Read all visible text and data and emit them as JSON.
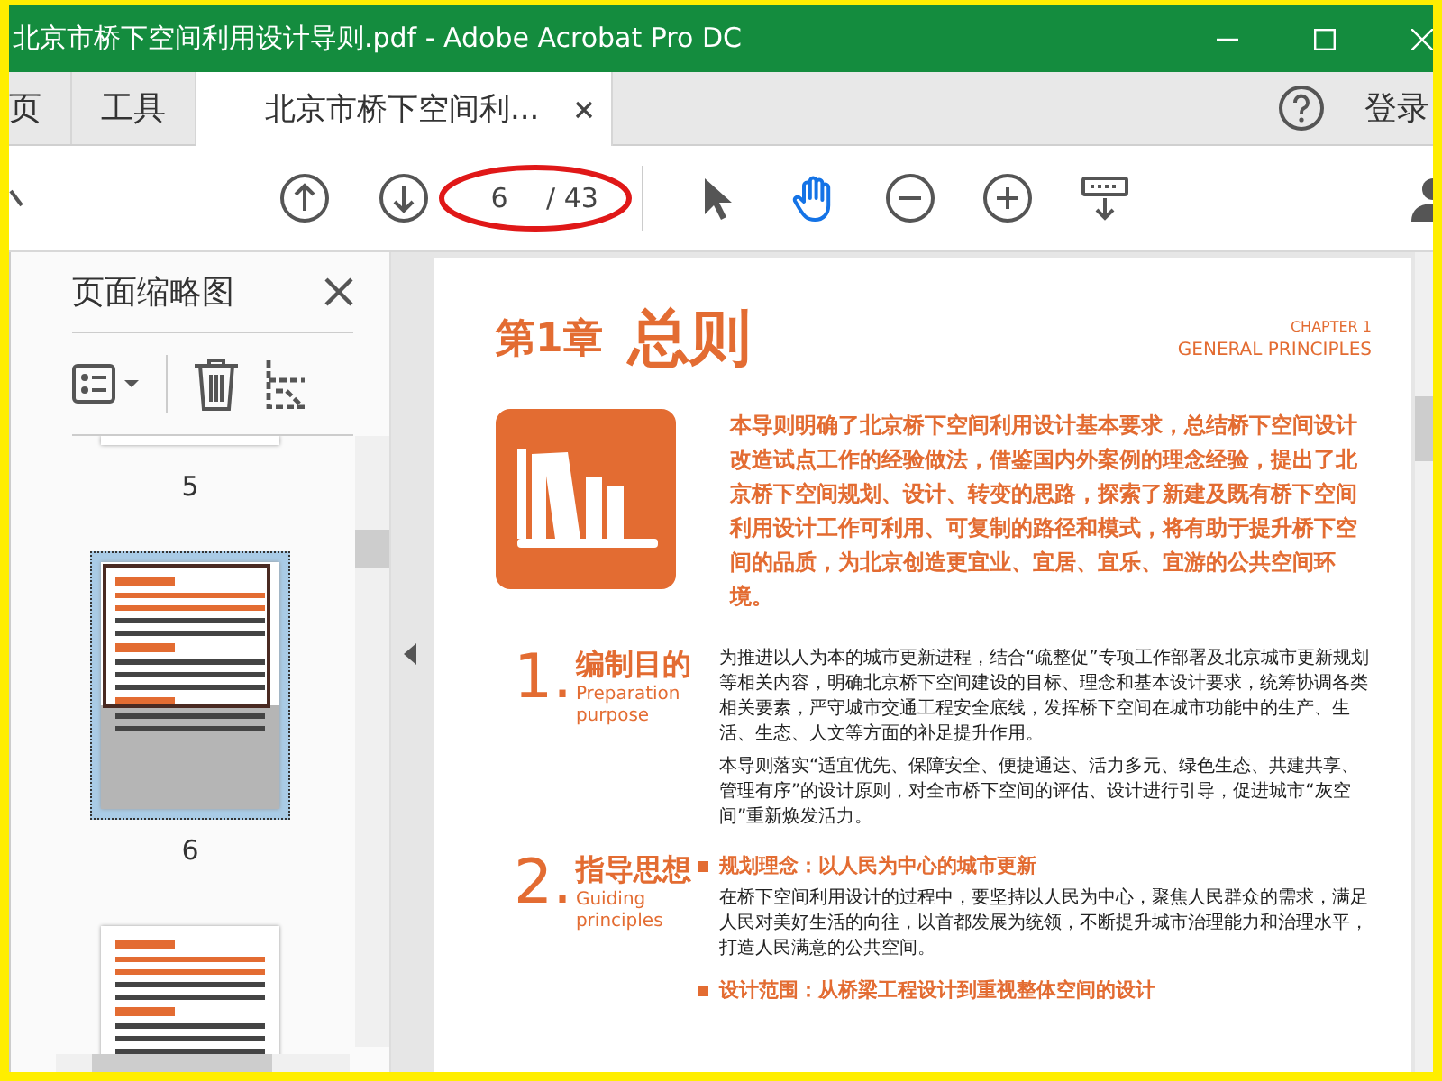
{
  "window": {
    "title": "北京市桥下空间利用设计导则.pdf - Adobe Acrobat Pro DC"
  },
  "tabs": [
    {
      "label": "页",
      "selected": false
    },
    {
      "label": "工具",
      "selected": false
    },
    {
      "label": "北京市桥下空间利...",
      "selected": true
    }
  ],
  "account": {
    "label": "登录"
  },
  "toolbar": {
    "page_value": "6",
    "page_total": "/ 43",
    "tools": [
      {
        "kind": "pointer",
        "selected": false
      },
      {
        "kind": "hand",
        "selected": true
      },
      {
        "kind": "zoom-out",
        "selected": false
      },
      {
        "kind": "zoom-in",
        "selected": false
      },
      {
        "kind": "keyboard",
        "selected": false
      }
    ]
  },
  "sidebar": {
    "title": "页面缩略图",
    "thumbnails": [
      {
        "label": "5",
        "selected": false,
        "kind": "partial"
      },
      {
        "label": "6",
        "selected": true,
        "kind": "full"
      },
      {
        "selected": false,
        "kind": "full"
      }
    ]
  },
  "document": {
    "chapter_label": "第1章",
    "chapter_title": "总则",
    "chapter_number_en": "CHAPTER 1",
    "chapter_title_en": "GENERAL PRINCIPLES",
    "intro": "本导则明确了北京桥下空间利用设计基本要求，总结桥下空间设计改造试点工作的经验做法，借鉴国内外案例的理念经验，提出了北京桥下空间规划、设计、转变的思路，探索了新建及既有桥下空间利用设计工作可利用、可复制的路径和模式，将有助于提升桥下空间的品质，为北京创造更宜业、宜居、宜乐、宜游的公共空间环境。",
    "sections": [
      {
        "number": "1.",
        "title": "编制目的",
        "title_en": "Preparation purpose",
        "paragraphs": [
          "为推进以人为本的城市更新进程，结合“疏整促”专项工作部署及北京城市更新规划等相关内容，明确北京桥下空间建设的目标、理念和基本设计要求，统筹协调各类相关要素，严守城市交通工程安全底线，发挥桥下空间在城市功能中的生产、生活、生态、人文等方面的补足提升作用。",
          "本导则落实“适宜优先、保障安全、便捷通达、活力多元、绿色生态、共建共享、管理有序”的设计原则，对全市桥下空间的评估、设计进行引导，促进城市“灰空间”重新焕发活力。"
        ]
      },
      {
        "number": "2.",
        "title": "指导思想",
        "title_en": "Guiding principles",
        "items": [
          {
            "heading": "规划理念：以人民为中心的城市更新",
            "text": "在桥下空间利用设计的过程中，要坚持以人民为中心，聚焦人民群众的需求，满足人民对美好生活的向往，以首都发展为统领，不断提升城市治理能力和治理水平，打造人民满意的公共空间。"
          },
          {
            "heading": "设计范围：从桥梁工程设计到重视整体空间的设计"
          }
        ]
      }
    ]
  }
}
